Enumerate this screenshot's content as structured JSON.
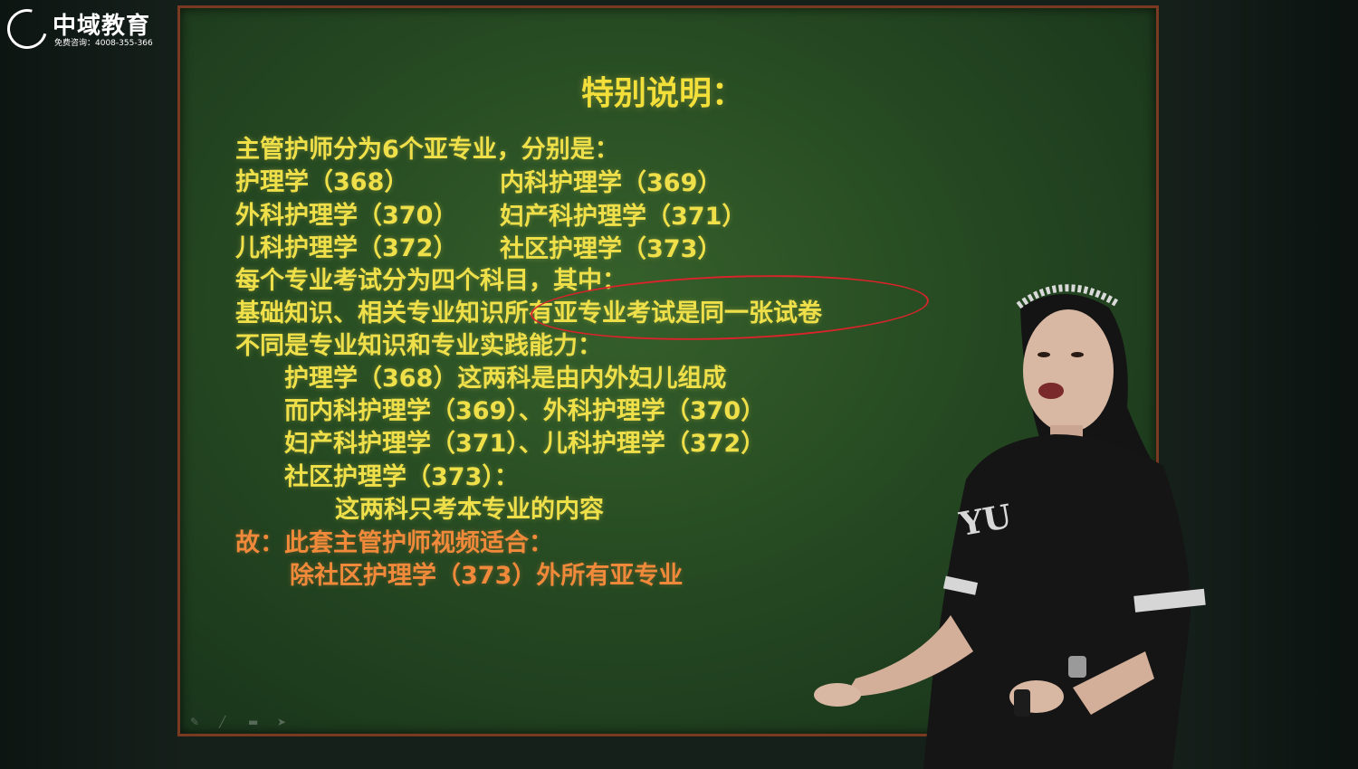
{
  "logo": {
    "name": "中域教育",
    "hotline": "免费咨询：4008-355-366"
  },
  "slide": {
    "title": "特别说明：",
    "intro": "主管护师分为6个亚专业，分别是：",
    "subjects": [
      "护理学（368）",
      "内科护理学（369）",
      "外科护理学（370）",
      "妇产科护理学（371）",
      "儿科护理学（372）",
      "社区护理学（373）"
    ],
    "exam_line": "每个专业考试分为四个科目，其中：",
    "same_paper_line": "基础知识、相关专业知识所有亚专业考试是同一张试卷",
    "diff_line": "不同是专业知识和专业实践能力：",
    "detail_lines": [
      "护理学（368）这两科是由内外妇儿组成",
      "而内科护理学（369）、外科护理学（370）",
      "妇产科护理学（371）、儿科护理学（372）",
      "社区护理学（373）：",
      "这两科只考本专业的内容"
    ],
    "conclusion_line1": "故：此套主管护师视频适合：",
    "conclusion_line2": "除社区护理学（373）外所有亚专业"
  },
  "shirt_text": "YU",
  "colors": {
    "board": "#264a22",
    "text_yellow": "#efe04a",
    "text_orange": "#f08a3a",
    "annotation_red": "#d8242a"
  }
}
